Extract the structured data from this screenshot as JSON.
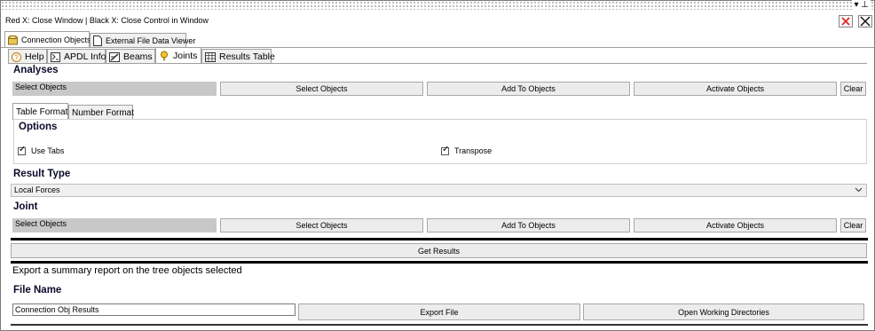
{
  "window": {
    "title": "Red X: Close Window | Black X: Close Control in Window",
    "pin_buttons": "▾ ⊥",
    "close_window_icon": "red-x-icon",
    "close_control_icon": "black-x-icon"
  },
  "top_tabs": [
    {
      "label": "Connection Objects",
      "icon": "connection-objects-icon",
      "active": true
    },
    {
      "label": "External File Data Viewer",
      "icon": "document-icon",
      "active": false
    }
  ],
  "sub_tabs": [
    {
      "label": "Help",
      "icon": "help-icon",
      "active": false
    },
    {
      "label": "APDL Info",
      "icon": "apdl-icon",
      "active": false
    },
    {
      "label": "Beams",
      "icon": "beam-icon",
      "active": false
    },
    {
      "label": "Joints",
      "icon": "joint-icon",
      "active": true
    },
    {
      "label": "Results Table",
      "icon": "table-icon",
      "active": false
    }
  ],
  "analyses": {
    "heading": "Analyses",
    "select_display": "Select Objects",
    "select_button": "Select Objects",
    "add_button": "Add To Objects",
    "activate_button": "Activate Objects",
    "clear_button": "Clear"
  },
  "format_tabs": [
    {
      "label": "Table Format",
      "active": true
    },
    {
      "label": "Number Format",
      "active": false
    }
  ],
  "options": {
    "heading": "Options",
    "use_tabs": {
      "label": "Use Tabs",
      "checked": true
    },
    "transpose": {
      "label": "Transpose",
      "checked": true
    }
  },
  "result_type": {
    "heading": "Result Type",
    "selected": "Local Forces"
  },
  "joint": {
    "heading": "Joint",
    "select_display": "Select Objects",
    "select_button": "Select Objects",
    "add_button": "Add To Objects",
    "activate_button": "Activate Objects",
    "clear_button": "Clear"
  },
  "get_results_button": "Get Results",
  "export": {
    "description": "Export a summary report on the tree objects selected",
    "file_name_heading": "File Name",
    "file_name_value": "Connection Obj Results",
    "export_button": "Export File",
    "open_dirs_button": "Open Working Directories"
  }
}
